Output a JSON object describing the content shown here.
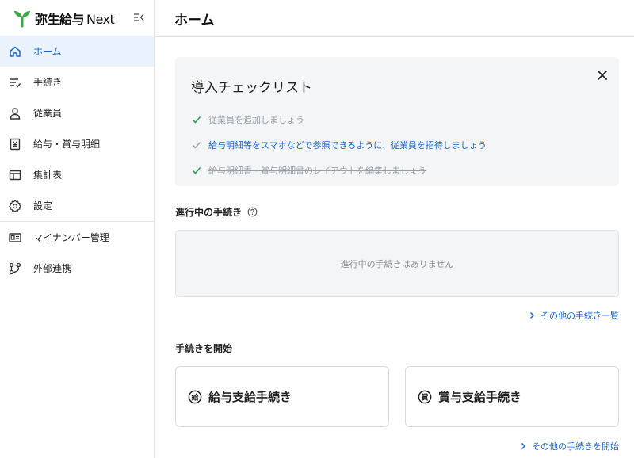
{
  "brand": {
    "name": "弥生給与",
    "suffix": "Next"
  },
  "header": {
    "title": "ホーム"
  },
  "sidebar": {
    "items": [
      {
        "label": "ホーム",
        "icon": "home-icon"
      },
      {
        "label": "手続き",
        "icon": "tasks-icon"
      },
      {
        "label": "従業員",
        "icon": "person-icon"
      },
      {
        "label": "給与・賞与明細",
        "icon": "yen-doc-icon"
      },
      {
        "label": "集計表",
        "icon": "table-icon"
      },
      {
        "label": "設定",
        "icon": "gear-icon"
      },
      {
        "label": "マイナンバー管理",
        "icon": "id-card-icon"
      },
      {
        "label": "外部連携",
        "icon": "link-nodes-icon"
      }
    ]
  },
  "checklist": {
    "title": "導入チェックリスト",
    "items": [
      {
        "text": "従業員を追加しましょう",
        "status": "done"
      },
      {
        "text": "給与明細等をスマホなどで参照できるように、従業員を招待しましょう",
        "status": "todo"
      },
      {
        "text": "給与明細書・賞与明細書のレイアウトを編集しましょう",
        "status": "done"
      }
    ]
  },
  "in_progress": {
    "title": "進行中の手続き",
    "empty_text": "進行中の手続きはありません",
    "more_link": "その他の手続き一覧"
  },
  "start": {
    "title": "手続きを開始",
    "cards": [
      {
        "label": "給与支給手続き",
        "icon": "salary-icon"
      },
      {
        "label": "賞与支給手続き",
        "icon": "bonus-icon"
      }
    ],
    "more_link": "その他の手続きを開始"
  },
  "colors": {
    "accent": "#1a66c9",
    "active_bg": "#eaf3fd",
    "check_green": "#2e9e4f",
    "logo_green": "#39a845"
  }
}
